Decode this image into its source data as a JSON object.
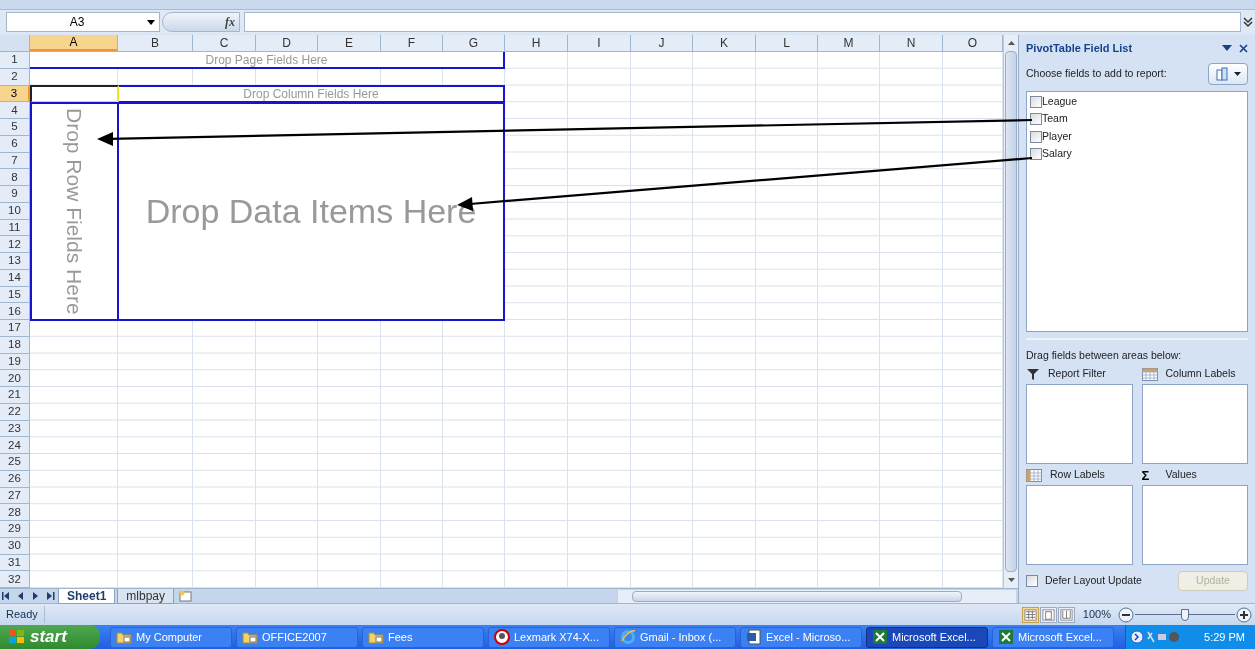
{
  "name_box": "A3",
  "function_label": "fx",
  "columns": [
    {
      "label": "A",
      "selected": true
    },
    {
      "label": "B",
      "selected": false
    },
    {
      "label": "C",
      "selected": false
    },
    {
      "label": "D",
      "selected": false
    },
    {
      "label": "E",
      "selected": false
    },
    {
      "label": "F",
      "selected": false
    },
    {
      "label": "G",
      "selected": false
    },
    {
      "label": "H",
      "selected": false
    },
    {
      "label": "I",
      "selected": false
    },
    {
      "label": "J",
      "selected": false
    },
    {
      "label": "K",
      "selected": false
    },
    {
      "label": "L",
      "selected": false
    },
    {
      "label": "M",
      "selected": false
    },
    {
      "label": "N",
      "selected": false
    },
    {
      "label": "O",
      "selected": false
    }
  ],
  "rows": [
    {
      "label": "1",
      "selected": false
    },
    {
      "label": "2",
      "selected": false
    },
    {
      "label": "3",
      "selected": true
    },
    {
      "label": "4",
      "selected": false
    },
    {
      "label": "5",
      "selected": false
    },
    {
      "label": "6",
      "selected": false
    },
    {
      "label": "7",
      "selected": false
    },
    {
      "label": "8",
      "selected": false
    },
    {
      "label": "9",
      "selected": false
    },
    {
      "label": "10",
      "selected": false
    },
    {
      "label": "11",
      "selected": false
    },
    {
      "label": "12",
      "selected": false
    },
    {
      "label": "13",
      "selected": false
    },
    {
      "label": "14",
      "selected": false
    },
    {
      "label": "15",
      "selected": false
    },
    {
      "label": "16",
      "selected": false
    },
    {
      "label": "17",
      "selected": false
    },
    {
      "label": "18",
      "selected": false
    },
    {
      "label": "19",
      "selected": false
    },
    {
      "label": "20",
      "selected": false
    },
    {
      "label": "21",
      "selected": false
    },
    {
      "label": "22",
      "selected": false
    },
    {
      "label": "23",
      "selected": false
    },
    {
      "label": "24",
      "selected": false
    },
    {
      "label": "25",
      "selected": false
    },
    {
      "label": "26",
      "selected": false
    },
    {
      "label": "27",
      "selected": false
    },
    {
      "label": "28",
      "selected": false
    },
    {
      "label": "29",
      "selected": false
    },
    {
      "label": "30",
      "selected": false
    },
    {
      "label": "31",
      "selected": false
    },
    {
      "label": "32",
      "selected": false
    }
  ],
  "pivot": {
    "page_fields": "Drop Page Fields Here",
    "column_fields": "Drop Column Fields Here",
    "row_fields": "Drop Row Fields Here",
    "data_items": "Drop Data Items Here"
  },
  "field_list": {
    "title": "PivotTable Field List",
    "choose_label": "Choose fields to add to report:",
    "fields": [
      {
        "name": "League",
        "checked": false
      },
      {
        "name": "Team",
        "checked": false
      },
      {
        "name": "Player",
        "checked": false
      },
      {
        "name": "Salary",
        "checked": false
      }
    ],
    "drag_label": "Drag fields between areas below:",
    "areas": [
      {
        "label": "Report Filter",
        "kind": "filter"
      },
      {
        "label": "Column Labels",
        "kind": "columns"
      },
      {
        "label": "Row Labels",
        "kind": "rows"
      },
      {
        "label": "Values",
        "kind": "values",
        "glyph": "Σ"
      }
    ],
    "defer": {
      "label": "Defer Layout Update",
      "checked": false
    },
    "update_button": {
      "label": "Update",
      "disabled": true
    }
  },
  "sheet_tabs": [
    {
      "label": "Sheet1",
      "selected": true
    },
    {
      "label": "mlbpay",
      "selected": false
    }
  ],
  "status": "Ready",
  "views": [
    {
      "kind": "normal",
      "selected": true
    },
    {
      "kind": "page_layout",
      "selected": false
    },
    {
      "kind": "page_break",
      "selected": false
    }
  ],
  "zoom": {
    "reading": "100%",
    "level": 0.5
  },
  "taskbar": {
    "start": "start",
    "items": [
      {
        "label": "My Computer",
        "kind": "folder",
        "selected": false
      },
      {
        "label": "OFFICE2007",
        "kind": "folder",
        "selected": false
      },
      {
        "label": "Fees",
        "kind": "folder",
        "selected": false
      },
      {
        "label": "Lexmark X74-X...",
        "kind": "printer",
        "selected": false
      },
      {
        "label": "Gmail - Inbox (...",
        "kind": "browser",
        "selected": false
      },
      {
        "label": "Excel - Microso...",
        "kind": "word",
        "selected": false
      },
      {
        "label": "Microsoft Excel...",
        "kind": "excel",
        "selected": true
      },
      {
        "label": "Microsoft Excel...",
        "kind": "excel",
        "selected": false
      }
    ],
    "clock": "5:29 PM"
  }
}
